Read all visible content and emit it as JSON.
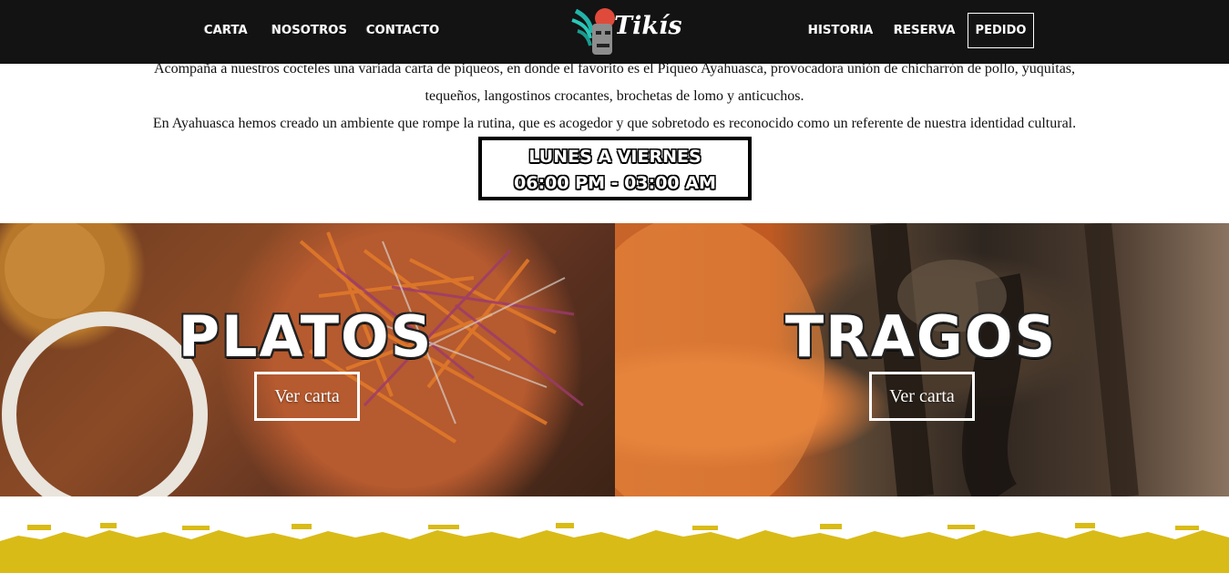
{
  "header": {
    "nav_left": [
      "CARTA",
      "NOSOTROS",
      "CONTACTO"
    ],
    "nav_right": [
      "HISTORIA",
      "RESERVA"
    ],
    "pedido_label": "PEDIDO",
    "logo_text": "Tikís"
  },
  "intro": {
    "line1": "Acompaña a nuestros cocteles una variada carta de piqueos, en donde el favorito es el Piqueo Ayahuasca, provocadora unión de chicharrón de pollo, yuquitas,",
    "line2": "tequeños, langostinos crocantes, brochetas de lomo y anticuchos.",
    "line3": "En Ayahuasca hemos creado un ambiente que rompe la rutina, que es acogedor y que sobretodo es reconocido como un referente de nuestra identidad cultural."
  },
  "hours": {
    "days": "LUNES A VIERNES",
    "time": "06:00 PM - 03:00 AM"
  },
  "panels": {
    "left": {
      "title": "PLATOS",
      "button": "Ver carta"
    },
    "right": {
      "title": "TRAGOS",
      "button": "Ver carta"
    }
  },
  "colors": {
    "header_bg": "#131313",
    "accent_yellow": "#d9bb17",
    "logo_teal": "#21b5a8"
  }
}
